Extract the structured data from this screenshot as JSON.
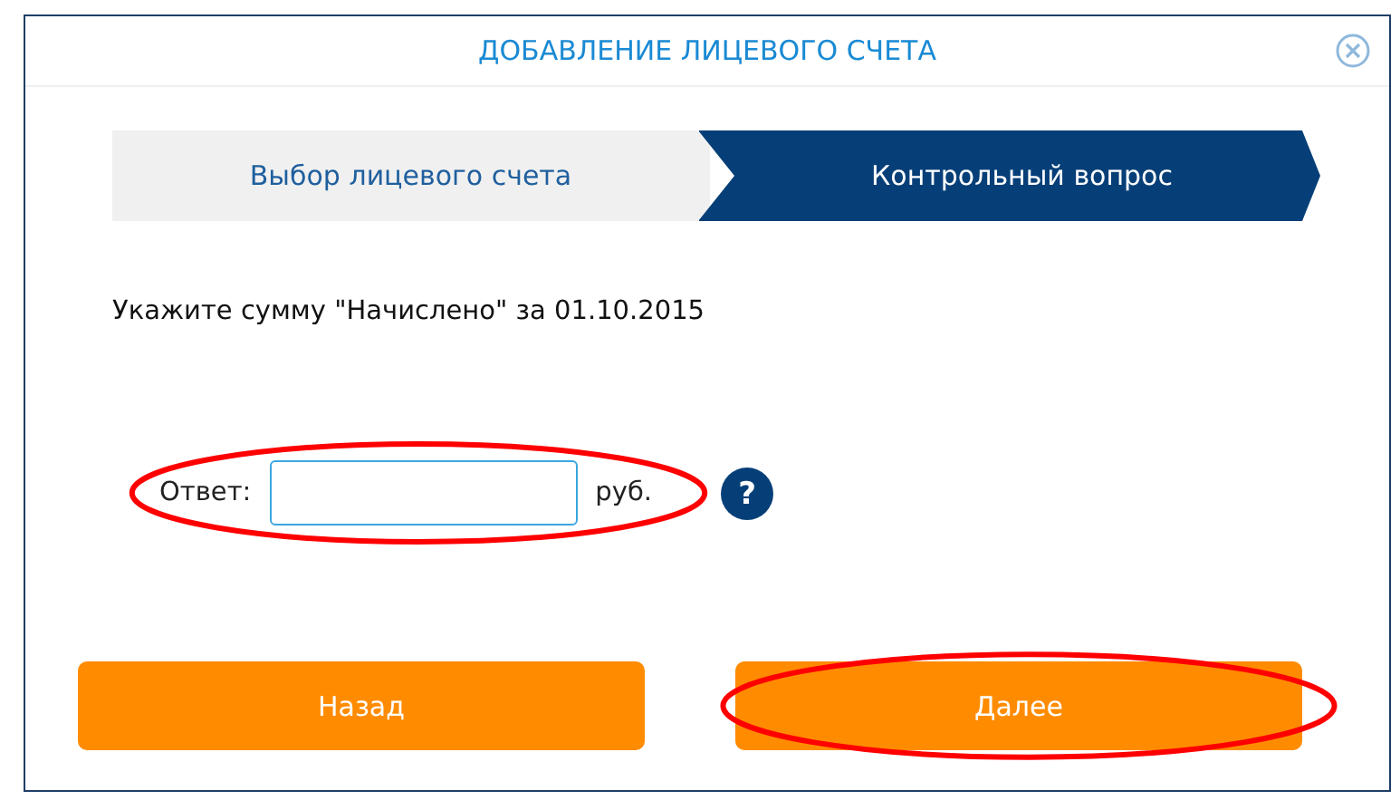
{
  "window": {
    "title": "ДОБАВЛЕНИЕ ЛИЦЕВОГО СЧЕТА"
  },
  "steps": [
    {
      "label": "Выбор лицевого счета",
      "selected": false
    },
    {
      "label": "Контрольный вопрос",
      "selected": true
    }
  ],
  "question": "Укажите сумму \"Начислено\" за 01.10.2015",
  "answer": {
    "label": "Ответ:",
    "unit": "руб.",
    "help": "?",
    "highlighted": true
  },
  "buttons": [
    {
      "label": "Назад",
      "highlighted": false
    },
    {
      "label": "Далее",
      "highlighted": true
    }
  ]
}
